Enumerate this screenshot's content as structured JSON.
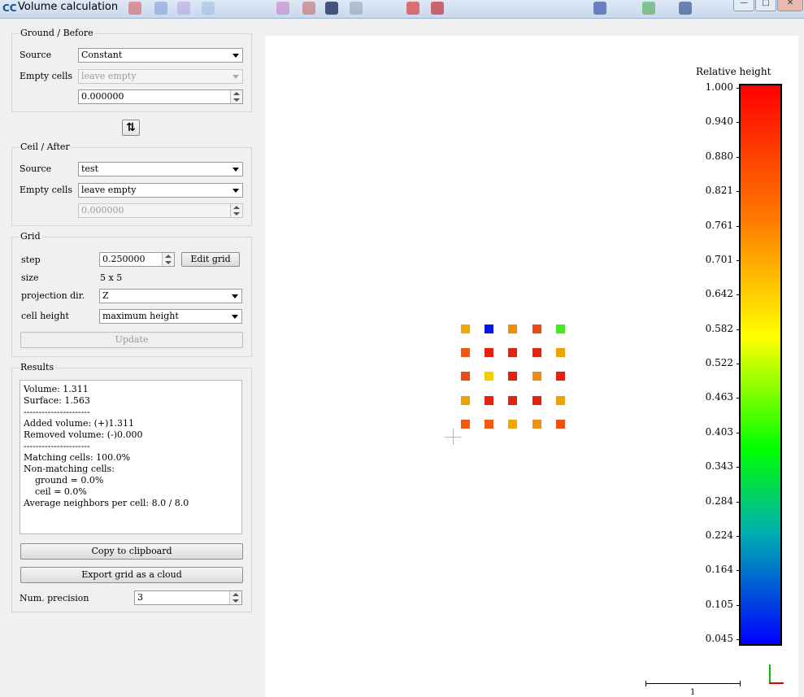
{
  "window": {
    "title": "Volume calculation",
    "app_icon": "CC"
  },
  "ground": {
    "title": "Ground / Before",
    "source_label": "Source",
    "source_value": "Constant",
    "empty_label": "Empty cells",
    "empty_value": "leave empty",
    "constant_value": "0.000000"
  },
  "ceil": {
    "title": "Ceil / After",
    "source_label": "Source",
    "source_value": "test",
    "empty_label": "Empty cells",
    "empty_value": "leave empty",
    "constant_value": "0.000000"
  },
  "grid": {
    "title": "Grid",
    "step_label": "step",
    "step_value": "0.250000",
    "edit_grid": "Edit grid",
    "size_label": "size",
    "size_value": "5 x 5",
    "projection_label": "projection dir.",
    "projection_value": "Z",
    "cell_height_label": "cell height",
    "cell_height_value": "maximum height",
    "update": "Update"
  },
  "results": {
    "title": "Results",
    "lines": [
      "Volume: 1.311",
      "Surface: 1.563",
      "----------------------",
      "Added volume: (+)1.311",
      "Removed volume: (-)0.000",
      "----------------------",
      "Matching cells: 100.0%",
      "Non-matching cells:",
      "    ground = 0.0%",
      "    ceil = 0.0%",
      "Average neighbors per cell: 8.0 / 8.0"
    ],
    "copy": "Copy to clipboard",
    "export": "Export grid as a cloud",
    "precision_label": "Num. precision",
    "precision_value": "3"
  },
  "view": {
    "colorbar_title": "Relative height",
    "ticks": [
      "1.000",
      "0.940",
      "0.880",
      "0.821",
      "0.761",
      "0.701",
      "0.642",
      "0.582",
      "0.522",
      "0.463",
      "0.403",
      "0.343",
      "0.284",
      "0.224",
      "0.164",
      "0.105",
      "0.045"
    ],
    "scale_label": "1",
    "cells": [
      [
        "#f2a800",
        "#0a14e6",
        "#f09000",
        "#f04a10",
        "#48e620"
      ],
      [
        "#f05a10",
        "#e82010",
        "#e82010",
        "#e82010",
        "#f0a000"
      ],
      [
        "#f04a10",
        "#f0d000",
        "#e82010",
        "#f08a10",
        "#e82010"
      ],
      [
        "#f0a000",
        "#e82010",
        "#e82010",
        "#e82010",
        "#f0a000"
      ],
      [
        "#f05a10",
        "#f05a10",
        "#f0a800",
        "#f09010",
        "#f05010"
      ]
    ]
  }
}
